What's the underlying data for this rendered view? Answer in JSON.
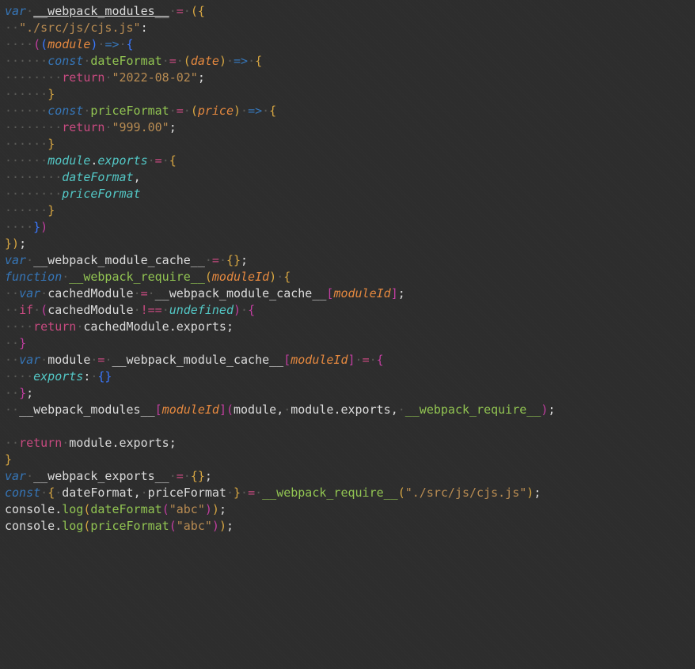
{
  "code": {
    "kw_var": "var",
    "kw_function": "function",
    "kw_if": "if",
    "kw_return": "return",
    "kw_const": "const",
    "kw_undefined": "undefined",
    "webpack_modules": "__webpack_modules__",
    "webpack_module_cache": "__webpack_module_cache__",
    "webpack_require": "__webpack_require__",
    "webpack_exports": "__webpack_exports__",
    "moduleId": "moduleId",
    "module": "module",
    "exports": "exports",
    "cachedModule": "cachedModule",
    "dateFormat": "dateFormat",
    "priceFormat": "priceFormat",
    "date": "date",
    "price": "price",
    "console": "console",
    "log": "log",
    "path_cjs": "\"./src/js/cjs.js\"",
    "str_date": "\"2022-08-02\"",
    "str_price": "\"999.00\"",
    "str_abc": "\"abc\"",
    "eq": "=",
    "neq": "!==",
    "arrow": "=>",
    "colon": ":",
    "semi": ";",
    "comma": ",",
    "dot": ".",
    "lp": "(",
    "rp": ")",
    "lb": "{",
    "rb": "}",
    "ls": "[",
    "rs": "]",
    "empty_obj": "{}",
    "ws1": "·",
    "ws2": "··",
    "ws4": "····",
    "ws6": "······",
    "ws8": "········"
  }
}
